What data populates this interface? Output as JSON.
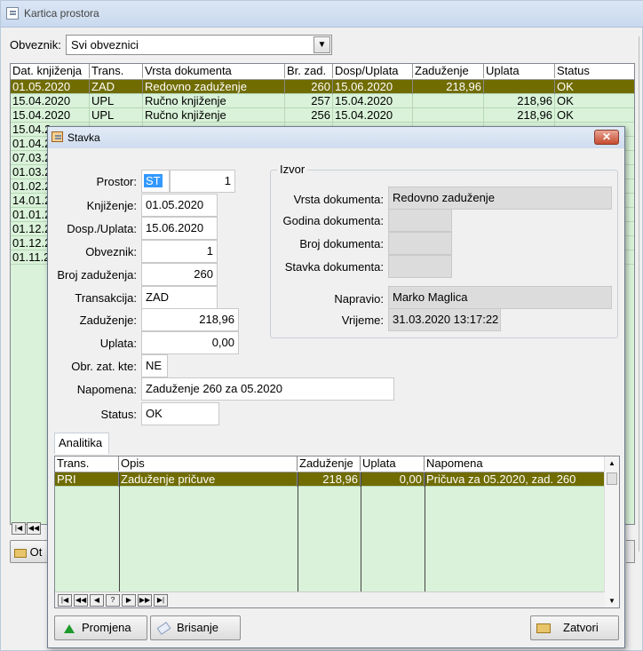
{
  "window": {
    "title": "Kartica prostora"
  },
  "filter": {
    "label": "Obveznik:",
    "value": "Svi obveznici"
  },
  "main_grid": {
    "columns": [
      "Dat. knjiženja",
      "Trans.",
      "Vrsta dokumenta",
      "Br. zad.",
      "Dosp/Uplata",
      "Zaduženje",
      "Uplata",
      "Status"
    ],
    "rows": [
      [
        "01.05.2020",
        "ZAD",
        "Redovno zaduženje",
        "260",
        "15.06.2020",
        "218,96",
        "",
        "OK"
      ],
      [
        "15.04.2020",
        "UPL",
        "Ručno knjiženje",
        "257",
        "15.04.2020",
        "",
        "218,96",
        "OK"
      ],
      [
        "15.04.2020",
        "UPL",
        "Ručno knjiženje",
        "256",
        "15.04.2020",
        "",
        "218,96",
        "OK"
      ],
      [
        "15.04.2",
        "",
        "",
        "",
        "",
        "",
        "",
        ""
      ],
      [
        "01.04.2",
        "",
        "",
        "",
        "",
        "",
        "",
        ""
      ],
      [
        "07.03.2",
        "",
        "",
        "",
        "",
        "",
        "",
        ""
      ],
      [
        "01.03.2",
        "",
        "",
        "",
        "",
        "",
        "",
        ""
      ],
      [
        "01.02.2",
        "",
        "",
        "",
        "",
        "",
        "",
        ""
      ],
      [
        "14.01.2",
        "",
        "",
        "",
        "",
        "",
        "",
        ""
      ],
      [
        "01.01.2",
        "",
        "",
        "",
        "",
        "",
        "",
        ""
      ],
      [
        "01.12.2",
        "",
        "",
        "",
        "",
        "",
        "",
        ""
      ],
      [
        "01.12.2",
        "",
        "",
        "",
        "",
        "",
        "",
        ""
      ],
      [
        "01.11.2",
        "",
        "",
        "",
        "",
        "",
        "",
        ""
      ]
    ]
  },
  "outer_button": {
    "label": "Ot"
  },
  "dialog": {
    "title": "Stavka",
    "close": "✕",
    "prostor": {
      "label": "Prostor:",
      "code": "ST",
      "number": "1"
    },
    "knjizenje": {
      "label": "Knjiženje:",
      "value": "01.05.2020"
    },
    "dosp": {
      "label": "Dosp./Uplata:",
      "value": "15.06.2020"
    },
    "obveznik": {
      "label": "Obveznik:",
      "value": "1"
    },
    "broj_zaduzenja": {
      "label": "Broj zaduženja:",
      "value": "260"
    },
    "transakcija": {
      "label": "Transakcija:",
      "value": "ZAD"
    },
    "zaduzenje": {
      "label": "Zaduženje:",
      "value": "218,96"
    },
    "uplata": {
      "label": "Uplata:",
      "value": "0,00"
    },
    "obr_zat_kte": {
      "label": "Obr. zat. kte:",
      "value": "NE"
    },
    "napomena": {
      "label": "Napomena:",
      "value": "Zaduženje 260 za 05.2020"
    },
    "status": {
      "label": "Status:",
      "value": "OK"
    },
    "izvor": {
      "title": "Izvor",
      "vrsta_label": "Vrsta dokumenta:",
      "vrsta_value": "Redovno zaduženje",
      "godina_label": "Godina dokumenta:",
      "godina_value": "",
      "broj_label": "Broj dokumenta:",
      "broj_value": "",
      "stavka_label": "Stavka dokumenta:",
      "stavka_value": "",
      "napravio_label": "Napravio:",
      "napravio_value": "Marko Maglica",
      "vrijeme_label": "Vrijeme:",
      "vrijeme_value": "31.03.2020 13:17:22"
    },
    "analitika": {
      "tab": "Analitika",
      "columns": [
        "Trans.",
        "Opis",
        "Zaduženje",
        "Uplata",
        "Napomena"
      ],
      "rows": [
        [
          "PRI",
          "Zaduženje pričuve",
          "218,96",
          "0,00",
          "Pričuva za 05.2020, zad. 260"
        ]
      ]
    },
    "buttons": {
      "promjena": "Promjena",
      "brisanje": "Brisanje",
      "zatvori": "Zatvori"
    }
  },
  "colors": {
    "selected_row": "#706c00",
    "grid_bg": "#d9f2d9"
  }
}
